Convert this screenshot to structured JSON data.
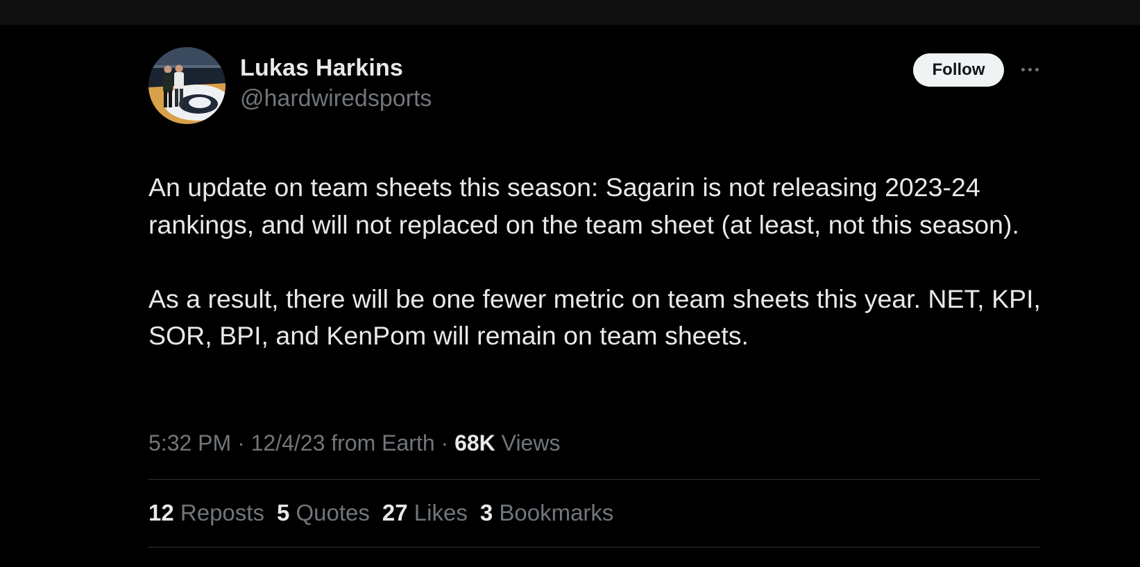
{
  "author": {
    "display_name": "Lukas Harkins",
    "handle": "@hardwiredsports",
    "avatar_icon": "profile-photo"
  },
  "actions": {
    "follow_label": "Follow",
    "more_icon": "more-horizontal-icon"
  },
  "tweet": {
    "paragraphs": [
      "An update on team sheets this season: Sagarin is not releasing 2023-24 rankings, and will not replaced on the team sheet (at least, not this season).",
      "As a result, there will be one fewer metric on team sheets this year. NET, KPI, SOR, BPI, and KenPom will remain on team sheets."
    ]
  },
  "meta": {
    "time": "5:32 PM",
    "separator": " · ",
    "date": "12/4/23",
    "source": "from Earth",
    "views_count": "68K",
    "views_label": "Views"
  },
  "stats": [
    {
      "count": "12",
      "label": "Reposts"
    },
    {
      "count": "5",
      "label": "Quotes"
    },
    {
      "count": "27",
      "label": "Likes"
    },
    {
      "count": "3",
      "label": "Bookmarks"
    }
  ],
  "colors": {
    "background": "#000000",
    "text_primary": "#e7e9ea",
    "text_secondary": "#71767b",
    "divider": "#2f3336",
    "follow_bg": "#eff3f4",
    "follow_text": "#0f1419"
  }
}
